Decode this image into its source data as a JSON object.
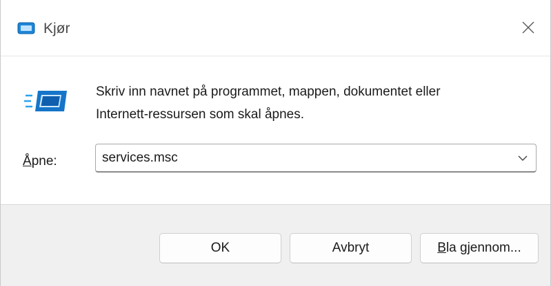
{
  "window": {
    "title": "Kjør"
  },
  "content": {
    "description_line1": "Skriv inn navnet på programmet, mappen, dokumentet eller",
    "description_line2": "Internett-ressursen som skal åpnes.",
    "open_label_accel": "Å",
    "open_label_rest": "pne:",
    "open_value": "services.msc"
  },
  "buttons": {
    "ok": "OK",
    "cancel": "Avbryt",
    "browse_accel": "B",
    "browse_rest": "la gjennom..."
  },
  "icons": {
    "title": "run-dialog-icon",
    "big": "run-dialog-icon",
    "close": "close-icon",
    "dropdown": "chevron-down-icon"
  },
  "colors": {
    "accent": "#0a6fc2",
    "footer_bg": "#f0f0f0"
  }
}
